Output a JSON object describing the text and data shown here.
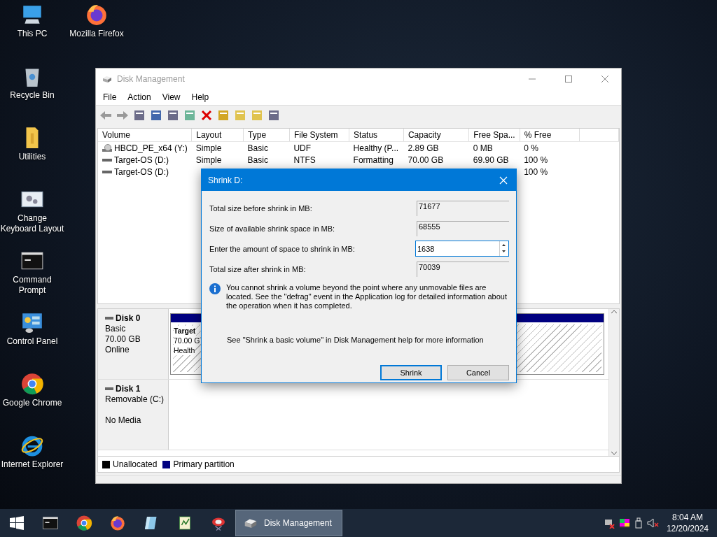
{
  "desktop_icons": [
    {
      "kind": "pc",
      "label": "This PC"
    },
    {
      "kind": "recycle",
      "label": "Recycle Bin"
    },
    {
      "kind": "folder",
      "label": "Utilities"
    },
    {
      "kind": "keyboard",
      "label": "Change Keyboard Layout"
    },
    {
      "kind": "cmd",
      "label": "Command Prompt"
    },
    {
      "kind": "control",
      "label": "Control Panel"
    },
    {
      "kind": "chrome",
      "label": "Google Chrome"
    },
    {
      "kind": "ie",
      "label": "Internet Explorer"
    },
    {
      "kind": "firefox",
      "label": "Mozilla Firefox"
    }
  ],
  "window": {
    "title": "Disk Management",
    "menu": [
      "File",
      "Action",
      "View",
      "Help"
    ],
    "columns": [
      "Volume",
      "Layout",
      "Type",
      "File System",
      "Status",
      "Capacity",
      "Free Spa...",
      "% Free"
    ],
    "rows": [
      {
        "kind": "cd",
        "cells": [
          "HBCD_PE_x64 (Y:)",
          "Simple",
          "Basic",
          "UDF",
          "Healthy (P...",
          "2.89 GB",
          "0 MB",
          "0 %"
        ]
      },
      {
        "kind": "disk",
        "cells": [
          "Target-OS (D:)",
          "Simple",
          "Basic",
          "NTFS",
          "Formatting",
          "70.00 GB",
          "69.90 GB",
          "100 %"
        ]
      },
      {
        "kind": "disk",
        "cells": [
          "Target-OS (D:)"
        ],
        "pct_free": "100 %"
      }
    ],
    "disks": [
      {
        "name": "Disk 0",
        "lines": [
          "Basic",
          "70.00 GB"
        ],
        "status": "Online",
        "partition": {
          "name": "Target",
          "size": "70.00 G",
          "status": "Health"
        }
      },
      {
        "name": "Disk 1",
        "lines": [
          "Removable (C:)"
        ],
        "status": "No Media"
      }
    ],
    "legend": [
      {
        "label": "Unallocated",
        "color": "#000000"
      },
      {
        "label": "Primary partition",
        "color": "#000080"
      }
    ]
  },
  "dialog": {
    "title": "Shrink D:",
    "fields": [
      {
        "label": "Total size before shrink in MB:",
        "value": "71677",
        "editable": false
      },
      {
        "label": "Size of available shrink space in MB:",
        "value": "68555",
        "editable": false
      },
      {
        "label": "Enter the amount of space to shrink in MB:",
        "value": "1638",
        "editable": true
      },
      {
        "label": "Total size after shrink in MB:",
        "value": "70039",
        "editable": false
      }
    ],
    "info": "You cannot shrink a volume beyond the point where any unmovable files are located. See the \"defrag\" event in the Application log for detailed information about the operation when it has completed.",
    "help": "See \"Shrink a basic volume\" in Disk Management help for more information",
    "buttons": [
      "Shrink",
      "Cancel"
    ]
  },
  "taskbar": {
    "apps": [
      {
        "kind": "cmd"
      },
      {
        "kind": "chrome"
      },
      {
        "kind": "firefox"
      },
      {
        "kind": "glass"
      },
      {
        "kind": "notepad"
      },
      {
        "kind": "tool"
      },
      {
        "kind": "diskmgmt",
        "label": "Disk Management",
        "selected": true
      }
    ],
    "time": "8:04 AM",
    "date": "12/20/2024"
  }
}
